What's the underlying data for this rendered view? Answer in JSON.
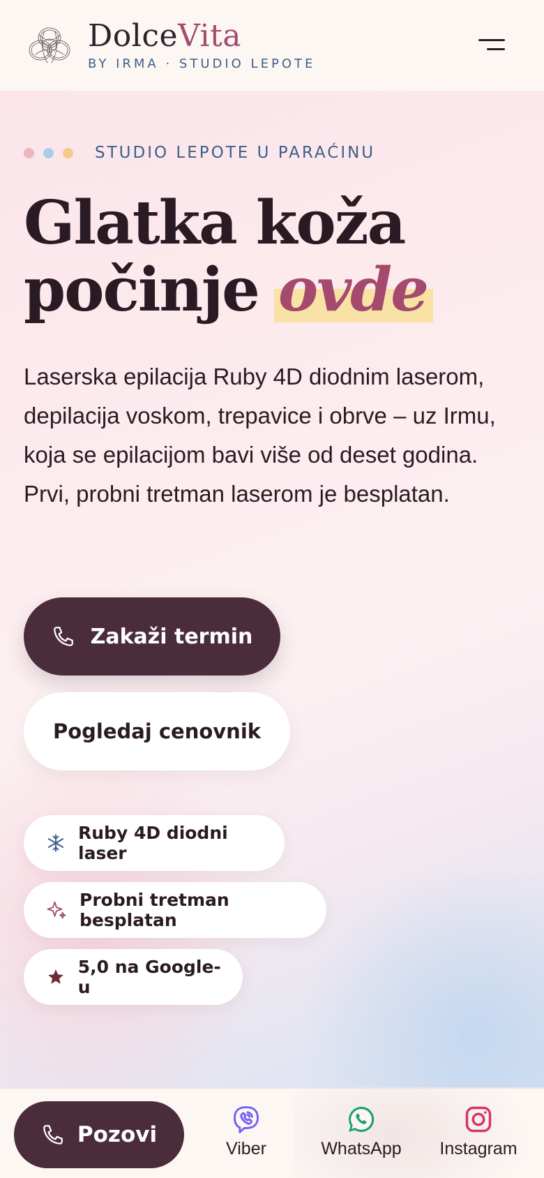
{
  "header": {
    "brand_main": "Dolce",
    "brand_accent": "Vita",
    "brand_sub": "BY IRMA · STUDIO LEPOTE",
    "logo_icon": "flower-logo-icon",
    "menu_icon": "hamburger-menu-icon"
  },
  "hero": {
    "eyebrow": "STUDIO LEPOTE U PARAĆINU",
    "eyebrow_dots": [
      "#e8b7bd",
      "#a9cde9",
      "#f5c98a"
    ],
    "headline_line1": "Glatka koža",
    "headline_line2_start": "počinje ",
    "headline_highlight": "ovde",
    "lead": "Laserska epilacija Ruby 4D diodnim laserom, depilacija voskom, trepavice i obrve – uz Irmu, koja se epilacijom bavi više od deset godina. Prvi, probni tretman laserom je besplatan.",
    "primary_button": "Zakaži termin",
    "secondary_button": "Pogledaj cenovnik",
    "chips": [
      {
        "icon": "snowflake-icon",
        "label": "Ruby 4D diodni laser"
      },
      {
        "icon": "sparkle-icon",
        "label": "Probni tretman besplatan"
      },
      {
        "icon": "star-icon",
        "label": "5,0 na Google-u"
      }
    ]
  },
  "bottom_bar": {
    "call_label": "Pozovi",
    "viber_label": "Viber",
    "whatsapp_label": "WhatsApp",
    "instagram_label": "Instagram"
  },
  "colors": {
    "accent": "#a34a6e",
    "primary_dark": "#4a2c3a",
    "secondary_blue": "#3d5f88",
    "highlight": "#f9e2a6"
  }
}
